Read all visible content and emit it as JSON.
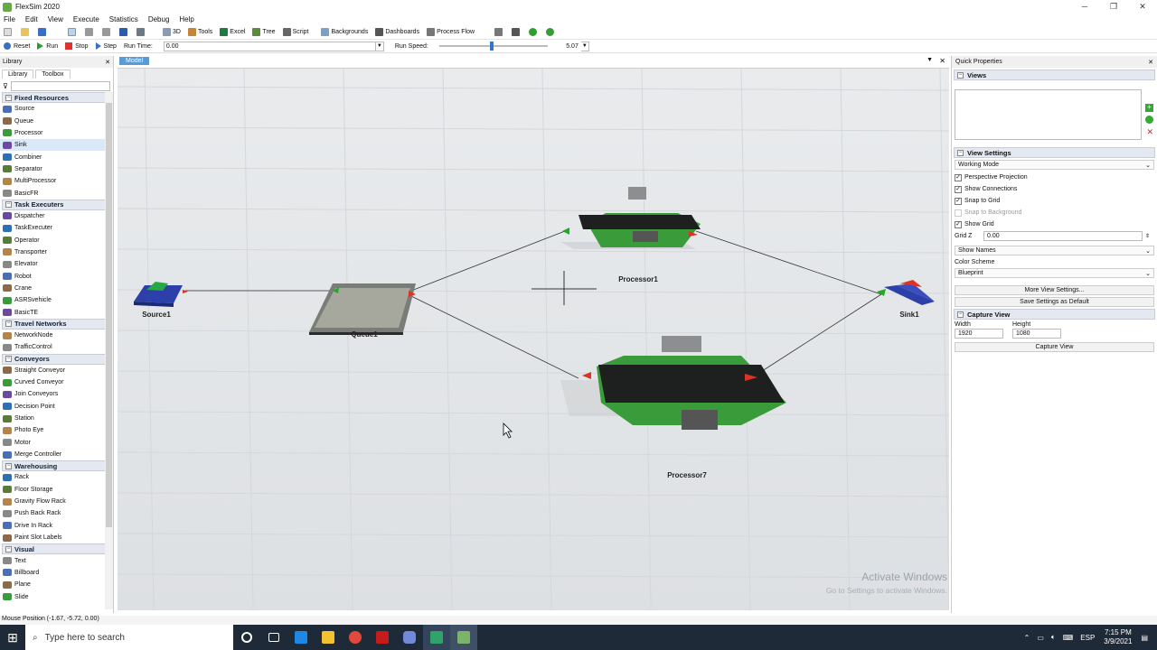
{
  "window": {
    "title": "FlexSim 2020"
  },
  "menu": [
    "File",
    "Edit",
    "View",
    "Execute",
    "Statistics",
    "Debug",
    "Help"
  ],
  "toolbar": {
    "items": [
      "3D",
      "Tools",
      "Excel",
      "Tree",
      "Script",
      "Backgrounds",
      "Dashboards",
      "Process Flow"
    ]
  },
  "runbar": {
    "reset": "Reset",
    "run": "Run",
    "stop": "Stop",
    "step": "Step",
    "run_time_label": "Run Time:",
    "run_time": "0.00",
    "run_speed_label": "Run Speed:",
    "run_speed": "5.07"
  },
  "library": {
    "title": "Library",
    "tabs": [
      "Library",
      "Toolbox"
    ],
    "categories": [
      {
        "name": "Fixed Resources",
        "items": [
          "Source",
          "Queue",
          "Processor",
          "Sink",
          "Combiner",
          "Separator",
          "MultiProcessor",
          "BasicFR"
        ]
      },
      {
        "name": "Task Executers",
        "items": [
          "Dispatcher",
          "TaskExecuter",
          "Operator",
          "Transporter",
          "Elevator",
          "Robot",
          "Crane",
          "ASRSvehicle",
          "BasicTE"
        ]
      },
      {
        "name": "Travel Networks",
        "items": [
          "NetworkNode",
          "TrafficControl"
        ]
      },
      {
        "name": "Conveyors",
        "items": [
          "Straight Conveyor",
          "Curved Conveyor",
          "Join Conveyors",
          "Decision Point",
          "Station",
          "Photo Eye",
          "Motor",
          "Merge Controller"
        ]
      },
      {
        "name": "Warehousing",
        "items": [
          "Rack",
          "Floor Storage",
          "Gravity Flow Rack",
          "Push Back Rack",
          "Drive In Rack",
          "Paint Slot Labels"
        ]
      },
      {
        "name": "Visual",
        "items": [
          "Text",
          "Billboard",
          "Plane",
          "Slide"
        ]
      }
    ]
  },
  "model_tab": "Model",
  "model": {
    "objects": {
      "source": "Source1",
      "queue": "Queue1",
      "processor1": "Processor1",
      "processor7": "Processor7",
      "sink": "Sink1"
    }
  },
  "quick_properties": {
    "title": "Quick Properties",
    "views": "Views",
    "view_settings": "View Settings",
    "mode": "Working Mode",
    "checks": [
      {
        "label": "Perspective Projection",
        "checked": true
      },
      {
        "label": "Show Connections",
        "checked": true
      },
      {
        "label": "Snap to Grid",
        "checked": true
      },
      {
        "label": "Snap to Background",
        "checked": false
      },
      {
        "label": "Show Grid",
        "checked": true
      }
    ],
    "gridz_label": "Grid Z",
    "gridz": "0.00",
    "show_names": "Show Names",
    "color_scheme_label": "Color Scheme",
    "color_scheme": "Blueprint",
    "more_btn": "More View Settings...",
    "save_btn": "Save Settings as Default",
    "capture": "Capture View",
    "width_label": "Width",
    "width": "1920",
    "height_label": "Height",
    "height": "1080",
    "capture_btn": "Capture View"
  },
  "status": "Mouse Position (-1.67, -5.72, 0.00)",
  "activate": {
    "line1": "Activate Windows",
    "line2": "Go to Settings to activate Windows."
  },
  "taskbar": {
    "search": "Type here to search",
    "lang": "ESP",
    "time": "7:15 PM",
    "date": "3/9/2021"
  }
}
